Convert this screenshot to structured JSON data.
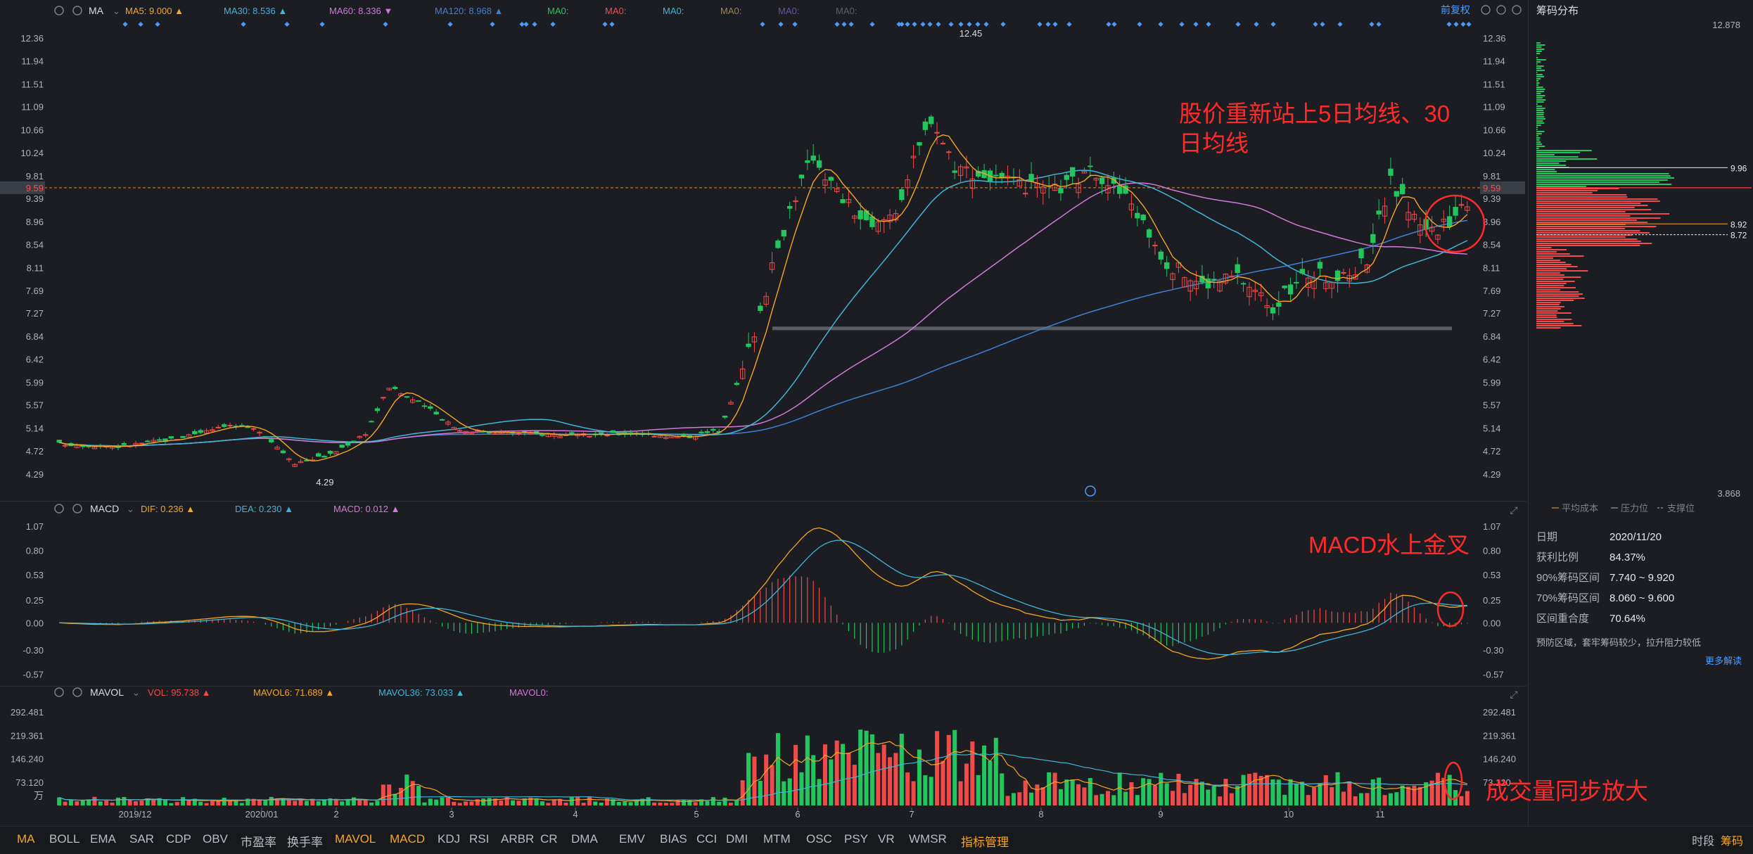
{
  "colors": {
    "bg": "#1b1d22",
    "up": "#f04a4a",
    "down": "#22c55e",
    "ma5": "#f5a623",
    "ma30": "#3fb6d8",
    "ma60": "#d17ad8",
    "ma120": "#3d7fd6",
    "annot": "#ff2a2a",
    "grid": "#262a31",
    "label": "#aeb3bb"
  },
  "main": {
    "indicator": "MA",
    "legend": [
      {
        "label": "MA5: 9.000",
        "color": "#f5a623",
        "arrow": "▲"
      },
      {
        "label": "MA30: 8.536",
        "color": "#3fb6d8",
        "arrow": "▲"
      },
      {
        "label": "MA60: 8.336",
        "color": "#d17ad8",
        "arrow": "▼"
      },
      {
        "label": "MA120: 8.968",
        "color": "#3d7fd6",
        "arrow": "▲"
      },
      {
        "label": "MA0:",
        "color": "#22c55e",
        "arrow": ""
      },
      {
        "label": "MA0:",
        "color": "#f04a4a",
        "arrow": ""
      },
      {
        "label": "MA0:",
        "color": "#3fb6d8",
        "arrow": ""
      },
      {
        "label": "MA0:",
        "color": "#a0805a",
        "arrow": ""
      },
      {
        "label": "MA0:",
        "color": "#6b4fa0",
        "arrow": ""
      },
      {
        "label": "MA0:",
        "color": "#5c5f66",
        "arrow": ""
      }
    ],
    "fq": "前复权",
    "yticks": [
      "12.36",
      "11.94",
      "11.51",
      "11.09",
      "10.66",
      "10.24",
      "9.81",
      "9.39",
      "8.96",
      "8.54",
      "8.11",
      "7.69",
      "7.27",
      "6.84",
      "6.42",
      "5.99",
      "5.57",
      "5.14",
      "4.72",
      "4.29"
    ],
    "current_price": "9.59",
    "high_label": "12.45",
    "low_label": "4.29",
    "annotation": "股价重新站上5日均线、30\n日均线"
  },
  "macd": {
    "indicator": "MACD",
    "legend": [
      {
        "label": "DIF: 0.236",
        "color": "#f5a623",
        "arrow": "▲"
      },
      {
        "label": "DEA: 0.230",
        "color": "#3fb6d8",
        "arrow": "▲"
      },
      {
        "label": "MACD: 0.012",
        "color": "#d17ad8",
        "arrow": "▲"
      }
    ],
    "yticks": [
      "1.07",
      "0.80",
      "0.53",
      "0.25",
      "0.00",
      "-0.30",
      "-0.57"
    ],
    "annotation": "MACD水上金叉"
  },
  "vol": {
    "indicator": "MAVOL",
    "legend": [
      {
        "label": "VOL: 95.738",
        "color": "#f04a4a",
        "arrow": "▲"
      },
      {
        "label": "MAVOL6: 71.689",
        "color": "#f5a623",
        "arrow": "▲"
      },
      {
        "label": "MAVOL36: 73.033",
        "color": "#3fb6d8",
        "arrow": "▲"
      },
      {
        "label": "MAVOL0:",
        "color": "#d17ad8",
        "arrow": ""
      }
    ],
    "yticks": [
      "292.481",
      "219.361",
      "146.240",
      "73.120"
    ],
    "unit": "万",
    "annotation": "成交量同步放大"
  },
  "xaxis": [
    "2019/12",
    "2020/01",
    "2",
    "3",
    "4",
    "5",
    "6",
    "7",
    "8",
    "9",
    "10",
    "11"
  ],
  "chips": {
    "title": "筹码分布",
    "top": "12.878",
    "bottom": "3.868",
    "levels": [
      "9.96",
      "8.92",
      "8.72"
    ],
    "legend": [
      "平均成本",
      "压力位",
      "支撑位"
    ],
    "rows": [
      {
        "k": "日期",
        "v": "2020/11/20"
      },
      {
        "k": "获利比例",
        "v": "84.37%"
      },
      {
        "k": "90%筹码区间",
        "v": "7.740 ~ 9.920"
      },
      {
        "k": "70%筹码区间",
        "v": "8.060 ~ 9.600"
      },
      {
        "k": "区间重合度",
        "v": "70.64%"
      }
    ],
    "note": "预防区域，套牢筹码较少，拉升阻力较低",
    "more": "更多解读"
  },
  "tabs": [
    "MA",
    "BOLL",
    "EMA",
    "SAR",
    "CDP",
    "OBV",
    "市盈率",
    "换手率",
    "MAVOL",
    "MACD",
    "KDJ",
    "RSI",
    "ARBR",
    "CR",
    "DMA",
    "EMV",
    "BIAS",
    "CCI",
    "DMI",
    "MTM",
    "OSC",
    "PSY",
    "VR",
    "WMSR",
    "指标管理"
  ],
  "footer": {
    "period": "时段",
    "chips": "筹码"
  }
}
